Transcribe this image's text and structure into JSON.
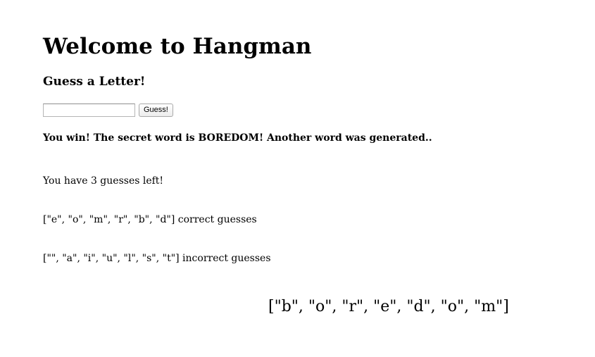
{
  "page": {
    "title": "Welcome to Hangman",
    "subtitle": "Guess a Letter!"
  },
  "form": {
    "input_value": "",
    "input_placeholder": "",
    "button_label": "Guess!"
  },
  "status": {
    "win_message": "You win! The secret word is BOREDOM! Another word was generated..",
    "guesses_left_prefix": "You have ",
    "guesses_left_count": "3",
    "guesses_left_suffix": " guesses left!"
  },
  "correct": {
    "list": "[\"e\", \"o\", \"m\", \"r\", \"b\", \"d\"]",
    "label": " correct guesses"
  },
  "incorrect": {
    "list": "[\"\", \"a\", \"i\", \"u\", \"l\", \"s\", \"t\"]",
    "label": " incorrect guesses"
  },
  "word": {
    "display": "[\"b\", \"o\", \"r\", \"e\", \"d\", \"o\", \"m\"]"
  }
}
